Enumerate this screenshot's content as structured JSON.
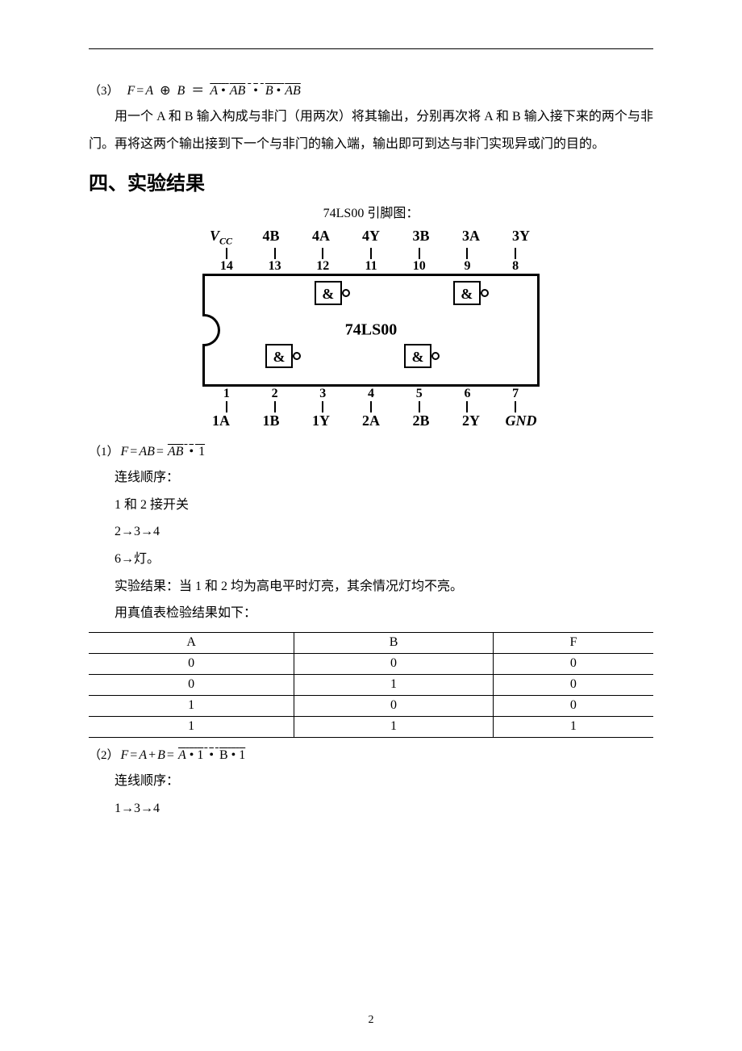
{
  "formula3": {
    "prefix": "（3）",
    "lhs_F": "F",
    "eq1": "=",
    "A": "A",
    "xor": "⊕",
    "B": "B",
    "eq2": "＝",
    "term1_A": "A",
    "dot": "•",
    "term1_AB": "AB",
    "term2_B": "B",
    "term2_AB": "AB"
  },
  "para1": "用一个 A 和 B 输入构成与非门（用两次）将其输出，分别再次将 A 和 B 输入接下来的两个与非门。再将这两个输出接到下一个与非门的输入端，输出即可到达与非门实现异或门的目的。",
  "section_heading": "四、实验结果",
  "caption": "74LS00 引脚图：",
  "pinout": {
    "top_labels": [
      "V",
      "4B",
      "4A",
      "4Y",
      "3B",
      "3A",
      "3Y"
    ],
    "vcc_sub": "CC",
    "top_nums": [
      "14",
      "13",
      "12",
      "11",
      "10",
      "9",
      "8"
    ],
    "chip_name": "74LS00",
    "gate_symbol": "&",
    "bot_nums": [
      "1",
      "2",
      "3",
      "4",
      "5",
      "6",
      "7"
    ],
    "bot_labels": [
      "1A",
      "1B",
      "1Y",
      "2A",
      "2B",
      "2Y",
      "GND"
    ]
  },
  "sub1": {
    "prefix": "（1）",
    "F": "F",
    "eq": "=",
    "AB": "AB",
    "eq2": "=",
    "ABbar": "AB",
    "dot": "•",
    "one": "1",
    "seq_label": "连线顺序：",
    "l1": "1 和 2 接开关",
    "l2": "2→3→4",
    "l3": "6→灯。",
    "result": "实验结果：当 1 和 2 均为高电平时灯亮，其余情况灯均不亮。",
    "check": "用真值表检验结果如下：",
    "table": {
      "headers": [
        "A",
        "B",
        "F"
      ],
      "rows": [
        [
          "0",
          "0",
          "0"
        ],
        [
          "0",
          "1",
          "0"
        ],
        [
          "1",
          "0",
          "0"
        ],
        [
          "1",
          "1",
          "1"
        ]
      ]
    }
  },
  "sub2": {
    "prefix": "（2）",
    "F": "F",
    "eq": "=",
    "A": "A",
    "plus": "+",
    "B": "B",
    "eq2": "=",
    "term_A": "A",
    "dot": "•",
    "one1": "1",
    "term_B": "B",
    "one2": "1",
    "seq_label": "连线顺序：",
    "l1": "1→3→4"
  },
  "page_num": "2"
}
